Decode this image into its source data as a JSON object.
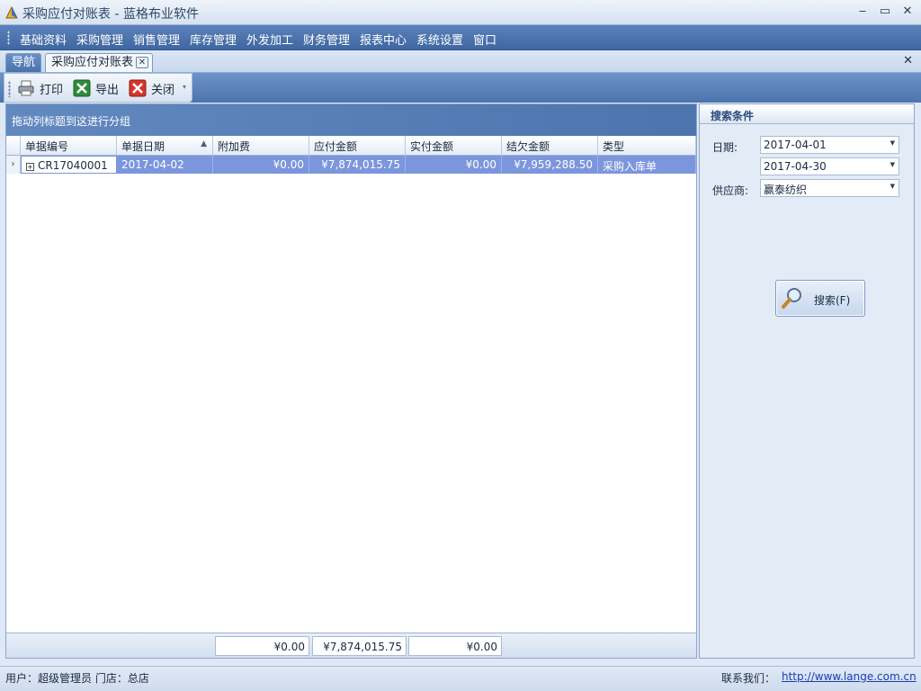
{
  "window": {
    "title": "采购应付对账表 - 蓝格布业软件",
    "minimize": "‒",
    "maximize": "▭",
    "close": "✕"
  },
  "menu": [
    "基础资料",
    "采购管理",
    "销售管理",
    "库存管理",
    "外发加工",
    "财务管理",
    "报表中心",
    "系统设置",
    "窗口"
  ],
  "tabs": {
    "nav": "导航",
    "active": "采购应付对账表",
    "tab_close": "✕",
    "bar_close": "✕"
  },
  "toolbar": {
    "print": "打印",
    "export": "导出",
    "close": "关闭",
    "more": "▾"
  },
  "grid": {
    "group_hint": "拖动列标题到这进行分组",
    "columns": [
      "单据编号",
      "单据日期",
      "附加费",
      "应付金额",
      "实付金额",
      "结欠金额",
      "类型"
    ],
    "sort_indicator": "▲",
    "rows": [
      {
        "indicator": "›",
        "expand": "+",
        "doc_no": "CR17040001",
        "date": "2017-04-02",
        "extra_fee": "¥0.00",
        "payable": "¥7,874,015.75",
        "paid": "¥0.00",
        "owed": "¥7,959,288.50",
        "type": "采购入库单"
      }
    ],
    "totals": {
      "extra_fee": "¥0.00",
      "payable": "¥7,874,015.75",
      "paid": "¥0.00"
    }
  },
  "search": {
    "title": "搜索条件",
    "date_label": "日期:",
    "date_from": "2017-04-01",
    "date_to": "2017-04-30",
    "supplier_label": "供应商:",
    "supplier": "赢泰纺织",
    "combo_arrow": "▼",
    "button": "搜索(F)"
  },
  "status": {
    "user": "用户：超级管理员  门店：总店",
    "contact": "联系我们：",
    "link": "http://www.lange.com.cn"
  },
  "colors": {
    "accent": "#4d74ad",
    "selected_row": "#7b96dc"
  }
}
